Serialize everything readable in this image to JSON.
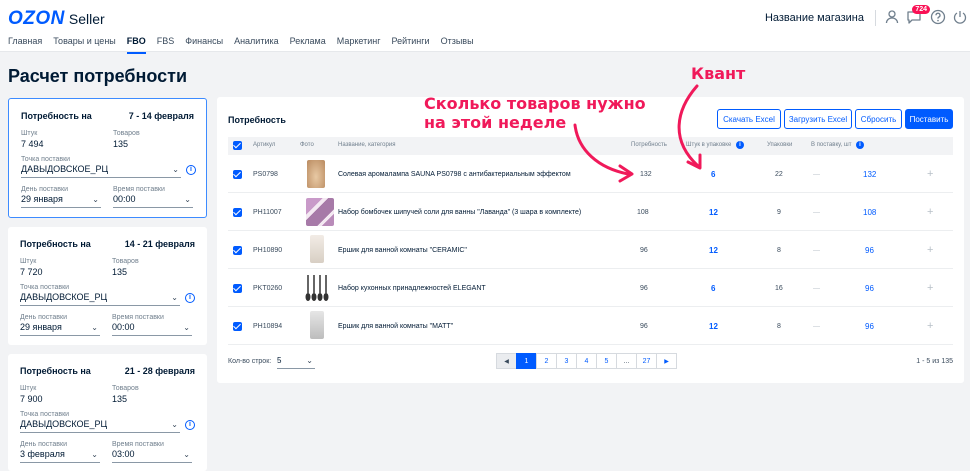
{
  "header": {
    "logo_brand": "OZON",
    "logo_product": "Seller",
    "store_name": "Название магазина",
    "notifications_count": "724",
    "icons": [
      "user-icon",
      "chat-icon",
      "help-icon"
    ],
    "nav": [
      {
        "label": "Главная",
        "active": false
      },
      {
        "label": "Товары и цены",
        "active": false
      },
      {
        "label": "FBO",
        "active": true
      },
      {
        "label": "FBS",
        "active": false
      },
      {
        "label": "Финансы",
        "active": false
      },
      {
        "label": "Аналитика",
        "active": false
      },
      {
        "label": "Реклама",
        "active": false
      },
      {
        "label": "Маркетинг",
        "active": false
      },
      {
        "label": "Рейтинги",
        "active": false
      },
      {
        "label": "Отзывы",
        "active": false
      }
    ]
  },
  "page_title": "Расчет потребности",
  "week_cards": [
    {
      "title": "Потребность на",
      "dates": "7 - 14 февраля",
      "qty_label": "Штук",
      "qty": "7 494",
      "goods_label": "Товаров",
      "goods": "135",
      "point_label": "Точка поставки",
      "point": "ДАВЫДОВСКОЕ_РЦ",
      "day_label": "День поставки",
      "day": "29 января",
      "time_label": "Время поставки",
      "time": "00:00"
    },
    {
      "title": "Потребность на",
      "dates": "14 - 21 февраля",
      "qty_label": "Штук",
      "qty": "7 720",
      "goods_label": "Товаров",
      "goods": "135",
      "point_label": "Точка поставки",
      "point": "ДАВЫДОВСКОЕ_РЦ",
      "day_label": "День поставки",
      "day": "29 января",
      "time_label": "Время поставки",
      "time": "00:00"
    },
    {
      "title": "Потребность на",
      "dates": "21 - 28 февраля",
      "qty_label": "Штук",
      "qty": "7 900",
      "goods_label": "Товаров",
      "goods": "135",
      "point_label": "Точка поставки",
      "point": "ДАВЫДОВСКОЕ_РЦ",
      "day_label": "День поставки",
      "day": "3 февраля",
      "time_label": "Время поставки",
      "time": "03:00"
    }
  ],
  "panel": {
    "title": "Потребность",
    "buttons": {
      "download": "Скачать Excel",
      "upload": "Загрузить Excel",
      "reset": "Сбросить",
      "supply": "Поставить"
    },
    "columns": {
      "article": "Артикул",
      "photo": "Фото",
      "name": "Название, категория",
      "need": "Потребность",
      "per_pack": "Штук в упаковке",
      "packs": "Упаковки",
      "to_supply": "В поставку, шт"
    },
    "rows": [
      {
        "article": "PS0798",
        "name": "Солевая аромалампа SAUNA PS0798 с антибактериальным эффектом",
        "need": "132",
        "per_pack": "6",
        "packs": "22",
        "dash": "—",
        "to_supply": "132",
        "photo_color": "#d9b48f"
      },
      {
        "article": "PH11007",
        "name": "Набор бомбочек шипучей соли для ванны \"Лаванда\" (3 шара в комплекте)",
        "need": "108",
        "per_pack": "12",
        "packs": "9",
        "dash": "—",
        "to_supply": "108",
        "photo_color": "#b58ab8"
      },
      {
        "article": "PH10890",
        "name": "Ершик для ванной комнаты \"CERAMIC\"",
        "need": "96",
        "per_pack": "12",
        "packs": "8",
        "dash": "—",
        "to_supply": "96",
        "photo_color": "#e8e1d8"
      },
      {
        "article": "PKT0260",
        "name": "Набор кухонных принадлежностей ELEGANT",
        "need": "96",
        "per_pack": "6",
        "packs": "16",
        "dash": "—",
        "to_supply": "96",
        "photo_color": "#3a3a3a"
      },
      {
        "article": "PH10894",
        "name": "Ершик для ванной комнаты \"MATT\"",
        "need": "96",
        "per_pack": "12",
        "packs": "8",
        "dash": "—",
        "to_supply": "96",
        "photo_color": "#cfcfcf"
      }
    ],
    "rows_label": "Кол-во строк:",
    "rows_value": "5",
    "pages": [
      "1",
      "2",
      "3",
      "4",
      "5",
      "...",
      "27"
    ],
    "range_text": "1 - 5 из 135"
  },
  "annotations": {
    "need_note_line1": "Сколько товаров нужно",
    "need_note_line2": "на этой неделе",
    "quant_note": "Квант",
    "color": "#f0195a"
  }
}
